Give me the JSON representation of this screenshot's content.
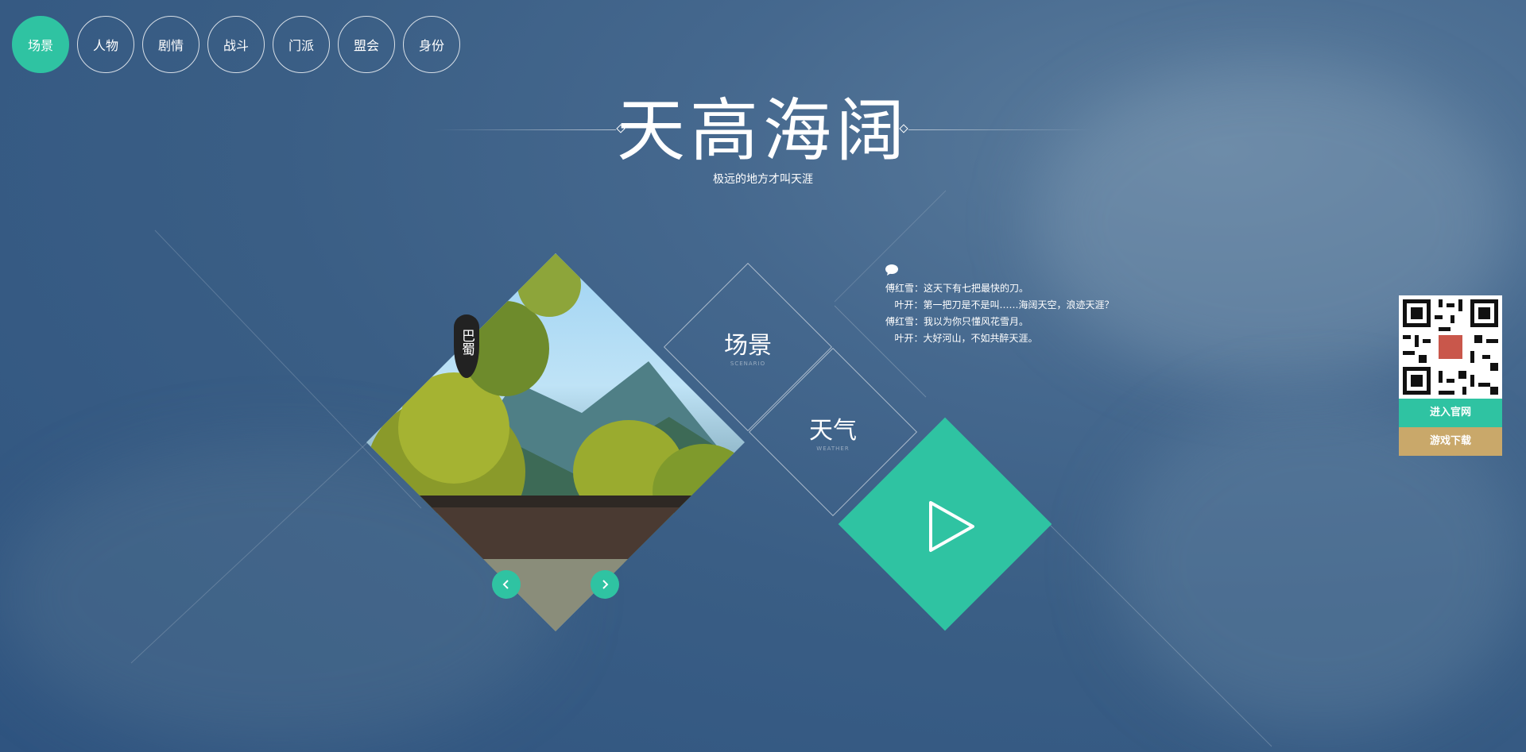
{
  "nav": {
    "items": [
      {
        "label": "场景",
        "active": true
      },
      {
        "label": "人物"
      },
      {
        "label": "剧情"
      },
      {
        "label": "战斗"
      },
      {
        "label": "门派"
      },
      {
        "label": "盟会"
      },
      {
        "label": "身份"
      }
    ]
  },
  "header": {
    "title": "天高海阔",
    "subtitle": "极远的地方才叫天涯"
  },
  "scene": {
    "place_tag": "巴蜀"
  },
  "tiles": {
    "scene_label": "场景",
    "scene_sub": "SCENARIO",
    "weather_label": "天气",
    "weather_sub": "WEATHER"
  },
  "dialog": {
    "lines": [
      "傅红雪：这天下有七把最快的刀。",
      "   叶开：第一把刀是不是叫……海阔天空，浪迹天涯？",
      "傅红雪：我以为你只懂风花雪月。",
      "   叶开：大好河山，不如共醉天涯。"
    ]
  },
  "side": {
    "official_site": "进入官网",
    "download": "游戏下载"
  },
  "colors": {
    "accent": "#2fc3a2",
    "gold": "#c9a86a"
  }
}
